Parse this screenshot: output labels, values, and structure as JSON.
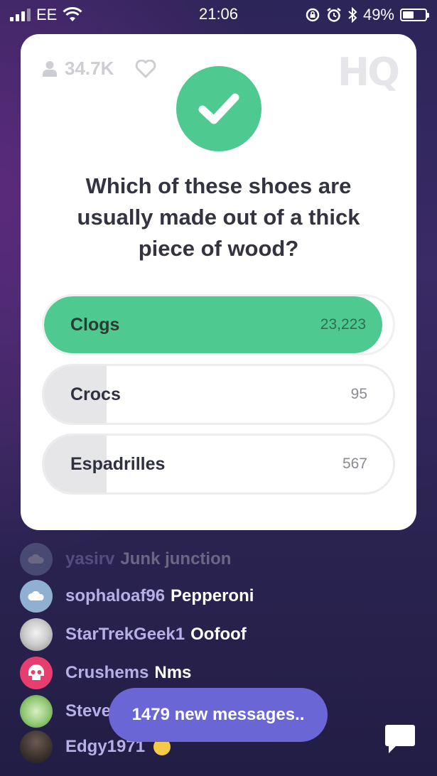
{
  "status_bar": {
    "carrier": "EE",
    "time": "21:06",
    "battery_percent_label": "49%",
    "battery_level": 0.49
  },
  "card": {
    "viewer_count": "34.7K",
    "logo": "HQ",
    "question": "Which of these shoes are usually made out of a thick piece of wood?",
    "answers": [
      {
        "label": "Clogs",
        "count": "23,223",
        "correct": true,
        "share": 0.97
      },
      {
        "label": "Crocs",
        "count": "95",
        "correct": false,
        "share": 0.18
      },
      {
        "label": "Espadrilles",
        "count": "567",
        "correct": false,
        "share": 0.18
      }
    ],
    "colors": {
      "correct": "#4ec98f",
      "bar": "#e6e6e9"
    }
  },
  "chat": {
    "messages": [
      {
        "user": "yasirv",
        "text": "Junk junction",
        "avatar": "cloud-avatar"
      },
      {
        "user": "sophaloaf96",
        "text": "Pepperoni",
        "avatar": "cloud-avatar"
      },
      {
        "user": "StarTrekGeek1",
        "text": "Oofoof",
        "avatar": "photo-avatar"
      },
      {
        "user": "Crushems",
        "text": "Nms",
        "avatar": "skull-avatar"
      },
      {
        "user": "Steve",
        "text": "",
        "avatar": "badge-avatar"
      },
      {
        "user": "Edgy1971",
        "text": "",
        "avatar": "photo-avatar"
      }
    ],
    "new_messages": "1479 new messages..",
    "accent": "#6a66d6"
  }
}
